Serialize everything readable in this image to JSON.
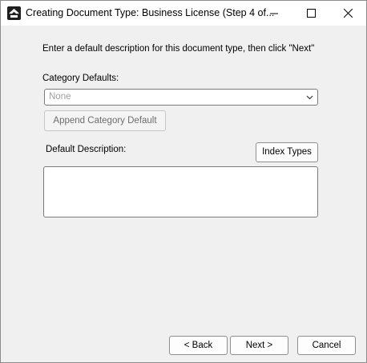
{
  "window": {
    "title": "Creating Document Type: Business License (Step 4 of...",
    "app_icon": "app-logo-icon",
    "controls": {
      "minimize_icon": "minimize-icon",
      "maximize_icon": "maximize-icon",
      "close_icon": "close-icon"
    }
  },
  "instructions": "Enter a default description for this document type, then click \"Next\"",
  "category_defaults": {
    "label": "Category Defaults:",
    "selected": "None",
    "dropdown_icon": "chevron-down-icon"
  },
  "append_button": "Append Category Default",
  "default_description": {
    "label": "Default Description:",
    "value": ""
  },
  "index_types_button": "Index Types",
  "footer": {
    "back": "< Back",
    "next": "Next >",
    "cancel": "Cancel"
  }
}
